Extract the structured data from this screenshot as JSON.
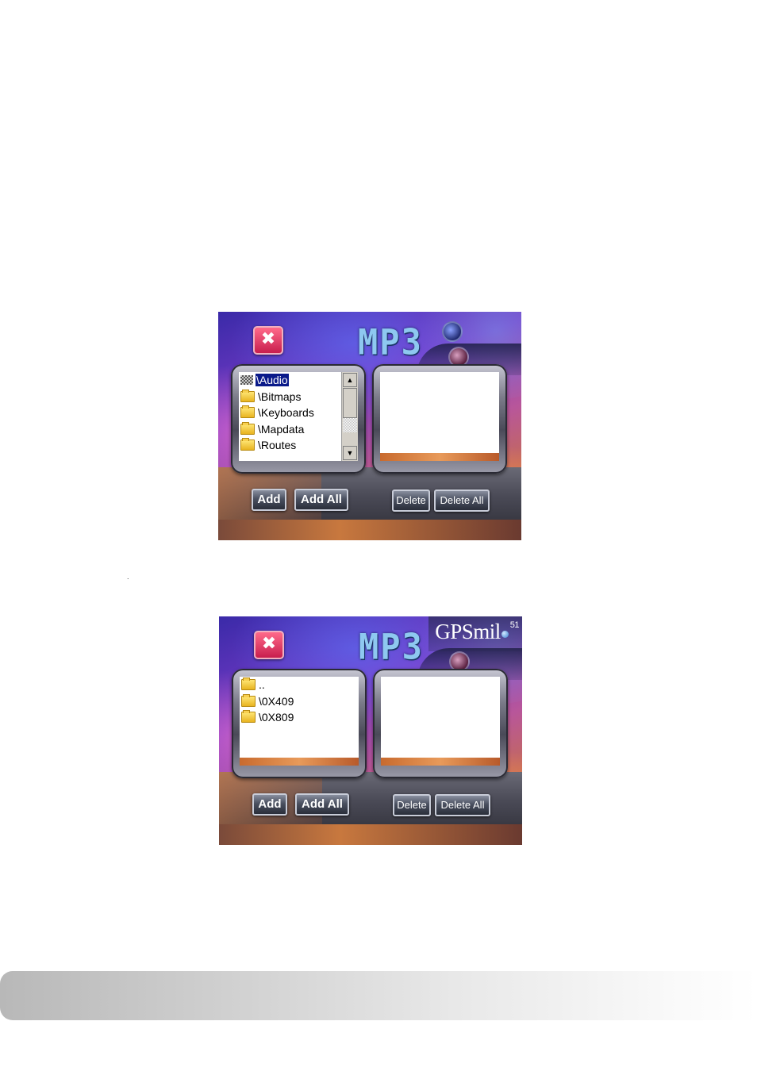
{
  "screen1": {
    "title": "MP3",
    "close_label": "✖",
    "source_list": [
      {
        "icon": "checker-icon",
        "label": "\\Audio",
        "selected": true
      },
      {
        "icon": "folder-icon",
        "label": "\\Bitmaps",
        "selected": false
      },
      {
        "icon": "folder-icon",
        "label": "\\Keyboards",
        "selected": false
      },
      {
        "icon": "folder-icon",
        "label": "\\Mapdata",
        "selected": false
      },
      {
        "icon": "folder-icon",
        "label": "\\Routes",
        "selected": false
      }
    ],
    "scroll_up": "▲",
    "scroll_down": "▼",
    "buttons": {
      "add": "Add",
      "add_all": "Add All",
      "delete": "Delete",
      "delete_all": "Delete All"
    }
  },
  "screen2": {
    "title": "MP3",
    "close_label": "✖",
    "brand": {
      "name": "GPSmil",
      "version": "51"
    },
    "source_list": [
      {
        "icon": "folder-icon",
        "label": ".."
      },
      {
        "icon": "folder-icon",
        "label": "\\0X409"
      },
      {
        "icon": "folder-icon",
        "label": "\\0X809"
      }
    ],
    "buttons": {
      "add": "Add",
      "add_all": "Add All",
      "delete": "Delete",
      "delete_all": "Delete All"
    }
  },
  "caption": "."
}
